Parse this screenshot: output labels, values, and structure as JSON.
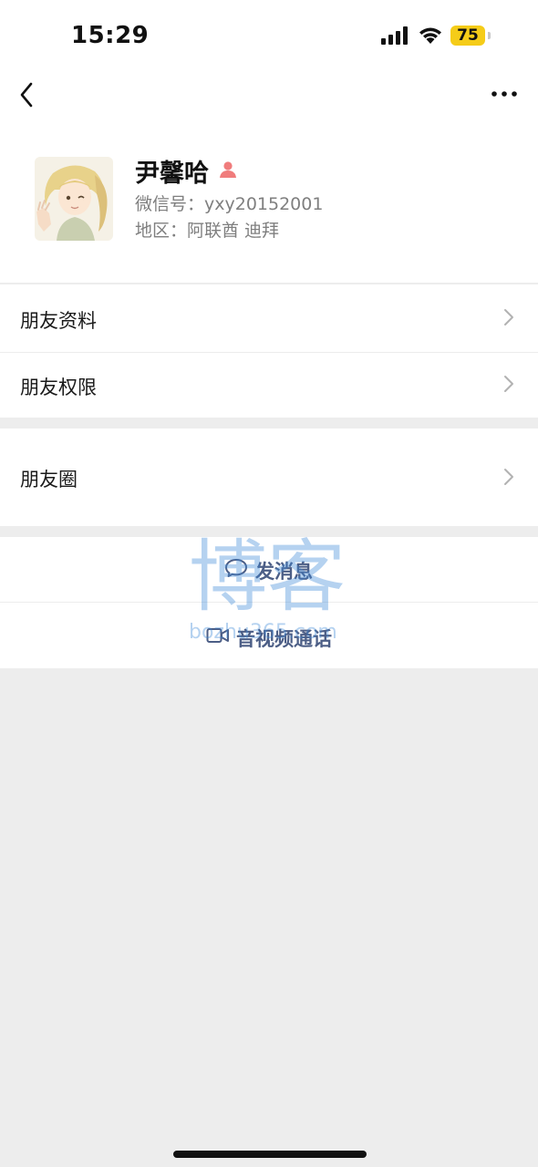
{
  "status_bar": {
    "time": "15:29",
    "battery": "75",
    "signal_icon": "cellular-signal-icon",
    "wifi_icon": "wifi-icon"
  },
  "nav": {
    "back_icon": "chevron-left-icon",
    "more_icon": "more-dots-icon"
  },
  "profile": {
    "name": "尹馨哈",
    "gender_icon": "female-person-icon",
    "wechat_id": "微信号：yxy20152001",
    "region": "地区：阿联酋 迪拜"
  },
  "menu": {
    "friend_info": "朋友资料",
    "friend_permissions": "朋友权限",
    "moments": "朋友圈"
  },
  "actions": {
    "send_message": "发消息",
    "video_call": "音视频通话",
    "message_icon": "chat-bubble-icon",
    "video_icon": "video-camera-icon"
  },
  "watermark": {
    "text": "博客",
    "subtext": "bozhu365.com"
  },
  "colors": {
    "accent_link": "#4c5e86",
    "gender_badge": "#f07c7c",
    "battery": "#f5cc18",
    "background": "#ededed"
  }
}
